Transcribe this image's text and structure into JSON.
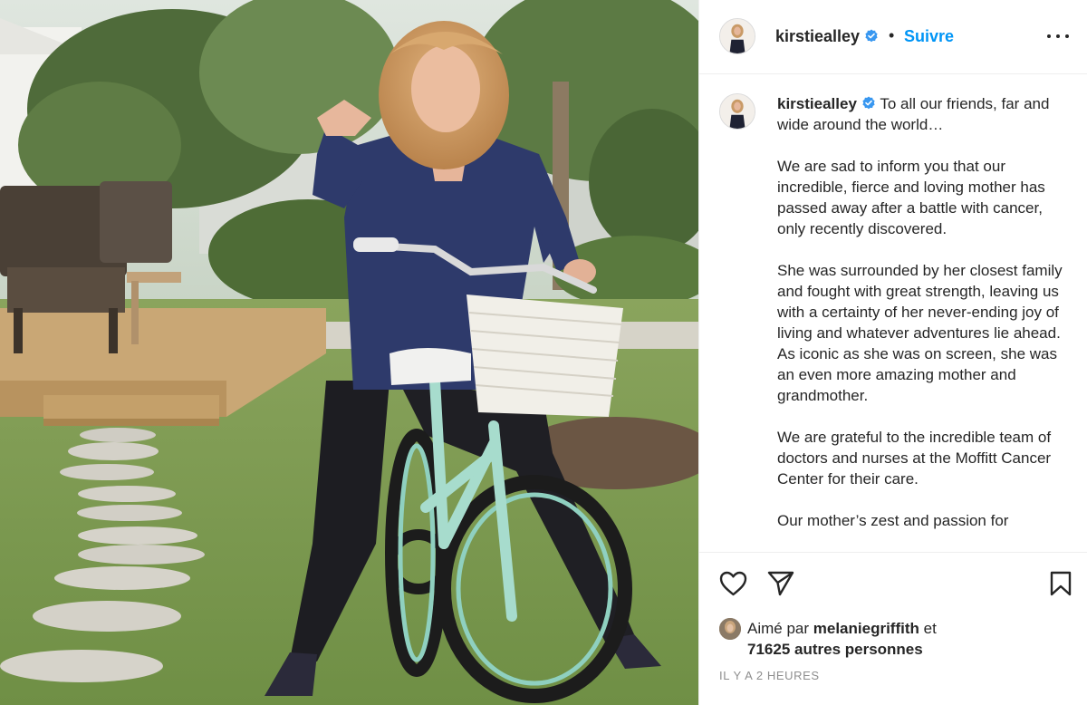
{
  "photo": {
    "alt_subject": "woman-with-bicycle-photo"
  },
  "header": {
    "username": "kirstiealley",
    "separator": "•",
    "follow_label": "Suivre"
  },
  "caption": {
    "username": "kirstiealley",
    "paragraphs": [
      "To all our friends, far and wide around the world…",
      "We are sad to inform you that our incredible, fierce and loving mother has passed away after a battle with cancer, only recently discovered.",
      "She was surrounded by her closest family and fought with great strength, leaving us with a certainty of her never-ending joy of living and whatever adventures lie ahead. As iconic as she was on screen, she was an even more amazing mother and grandmother.",
      "We are grateful to the incredible team of doctors and nurses at the Moffitt Cancer Center for their care.",
      "Our mother’s zest and passion for"
    ]
  },
  "actions": {
    "like_icon": "heart-icon",
    "share_icon": "paper-plane-icon",
    "save_icon": "bookmark-icon"
  },
  "likes": {
    "prefix": "Aimé par",
    "liker": "melaniegriffith",
    "connector": "et",
    "others": "71625 autres personnes"
  },
  "timestamp": "IL Y A 2 HEURES",
  "colors": {
    "link_blue": "#0095f6",
    "verified_blue": "#3897f0",
    "text": "#262626",
    "muted": "#8e8e8e",
    "divider": "#efefef"
  }
}
